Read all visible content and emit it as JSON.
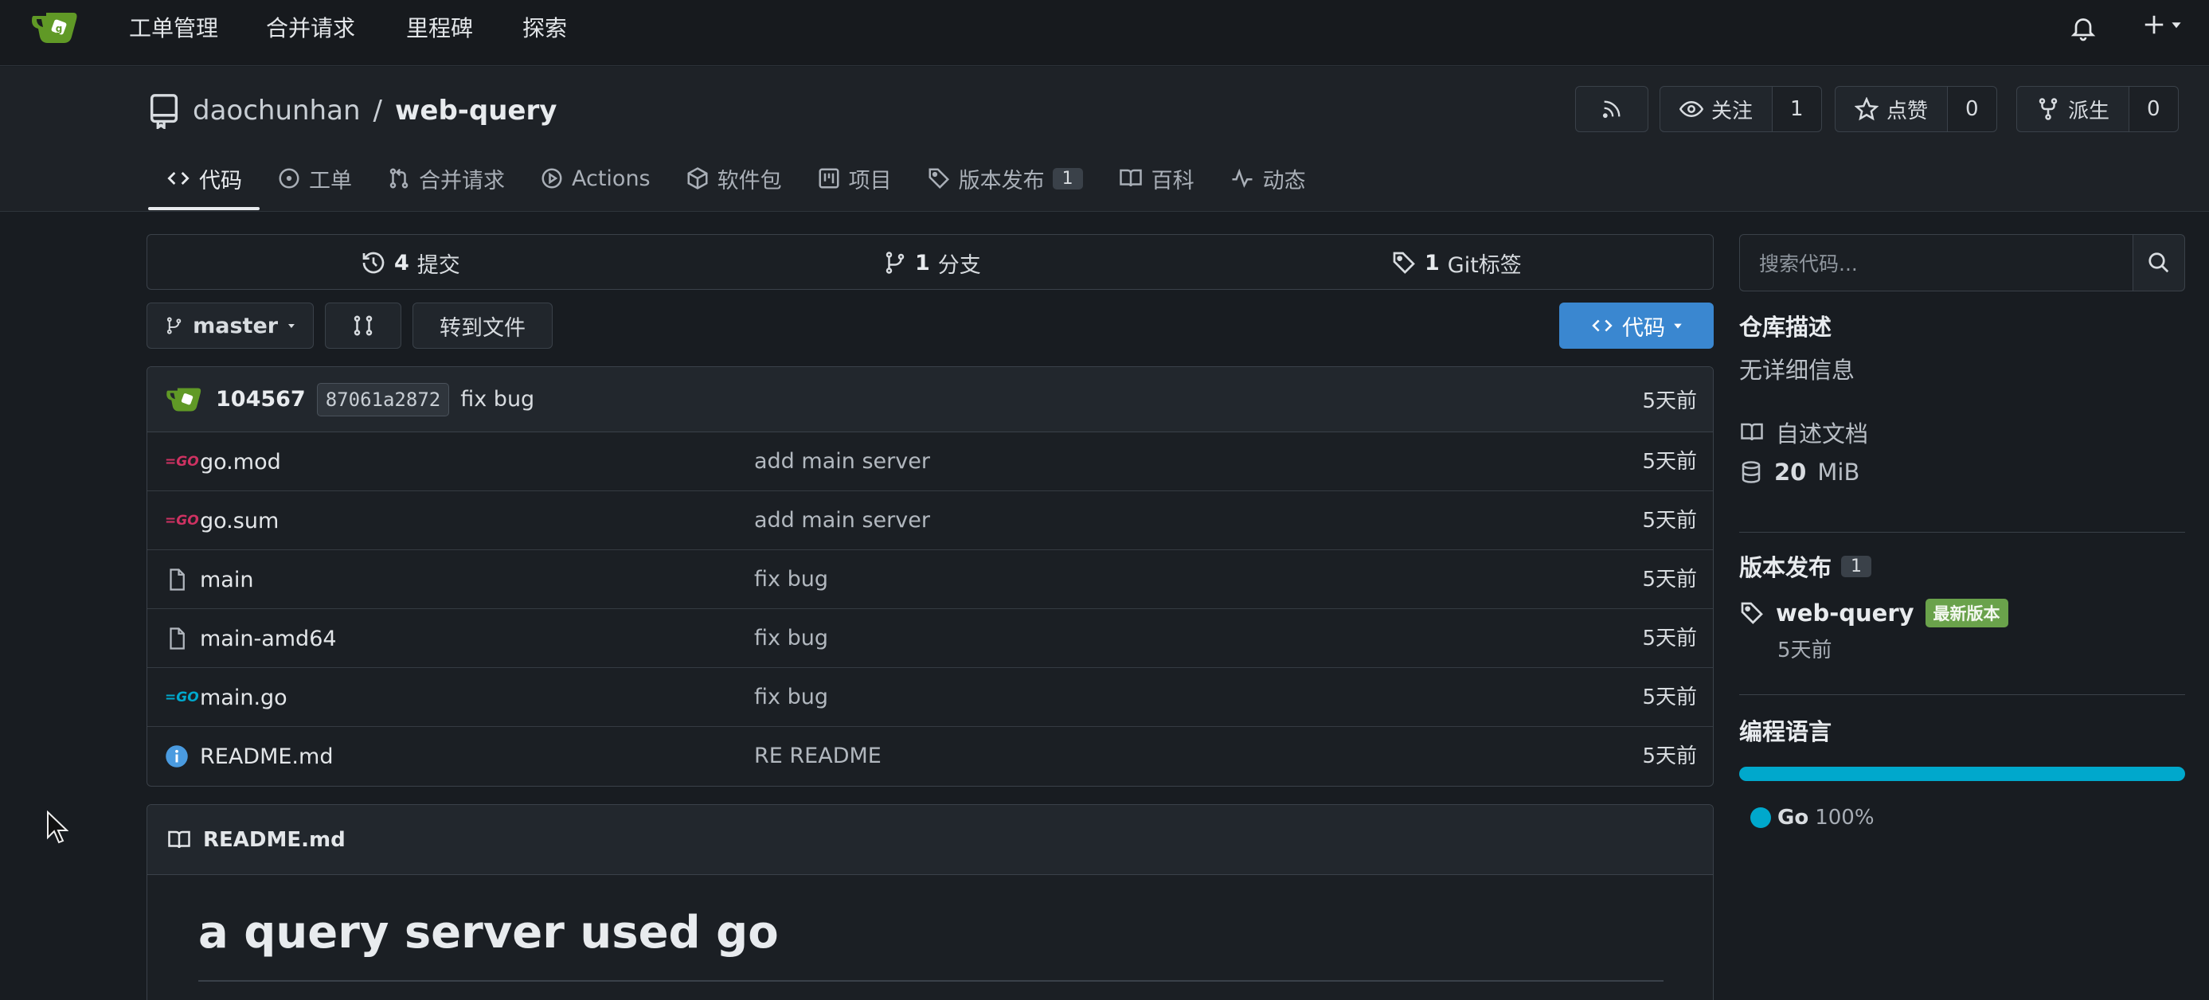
{
  "topnav": {
    "items": [
      "工单管理",
      "合并请求",
      "里程碑",
      "探索"
    ]
  },
  "repo": {
    "owner": "daochunhan",
    "separator": "/",
    "name": "web-query",
    "watch_label": "关注",
    "watch_count": "1",
    "star_label": "点赞",
    "star_count": "0",
    "fork_label": "派生",
    "fork_count": "0"
  },
  "tabs": [
    {
      "label": "代码",
      "icon": "code-icon",
      "active": true
    },
    {
      "label": "工单",
      "icon": "issue-icon"
    },
    {
      "label": "合并请求",
      "icon": "pull-request-icon"
    },
    {
      "label": "Actions",
      "icon": "play-icon"
    },
    {
      "label": "软件包",
      "icon": "package-icon"
    },
    {
      "label": "项目",
      "icon": "project-icon"
    },
    {
      "label": "版本发布",
      "icon": "tag-icon",
      "badge": "1"
    },
    {
      "label": "百科",
      "icon": "book-icon"
    },
    {
      "label": "动态",
      "icon": "pulse-icon"
    }
  ],
  "stats": {
    "commits_count": "4",
    "commits_label": "提交",
    "branches_count": "1",
    "branches_label": "分支",
    "tags_count": "1",
    "tags_label": "Git标签"
  },
  "toolbar": {
    "branch": "master",
    "goto_file": "转到文件",
    "code_button": "代码"
  },
  "latest_commit": {
    "author": "104567",
    "sha": "87061a2872",
    "message": "fix bug",
    "time": "5天前"
  },
  "files": [
    {
      "name": "go.mod",
      "message": "add main server",
      "time": "5天前",
      "icon": "go-icon"
    },
    {
      "name": "go.sum",
      "message": "add main server",
      "time": "5天前",
      "icon": "go-icon"
    },
    {
      "name": "main",
      "message": "fix bug",
      "time": "5天前",
      "icon": "file-icon"
    },
    {
      "name": "main-amd64",
      "message": "fix bug",
      "time": "5天前",
      "icon": "file-icon"
    },
    {
      "name": "main.go",
      "message": "fix bug",
      "time": "5天前",
      "icon": "go-icon"
    },
    {
      "name": "README.md",
      "message": "RE README",
      "time": "5天前",
      "icon": "info-icon"
    }
  ],
  "readme": {
    "filename": "README.md",
    "heading": "a query server used go"
  },
  "sidebar": {
    "search_placeholder": "搜索代码...",
    "desc_title": "仓库描述",
    "desc_text": "无详细信息",
    "readme_link": "自述文档",
    "size_value": "20",
    "size_unit": "MiB",
    "releases_title": "版本发布",
    "releases_count": "1",
    "release_name": "web-query",
    "release_badge": "最新版本",
    "release_time": "5天前",
    "languages_title": "编程语言",
    "language_name": "Go",
    "language_percent": "100%",
    "language_color": "#00a8cc"
  }
}
